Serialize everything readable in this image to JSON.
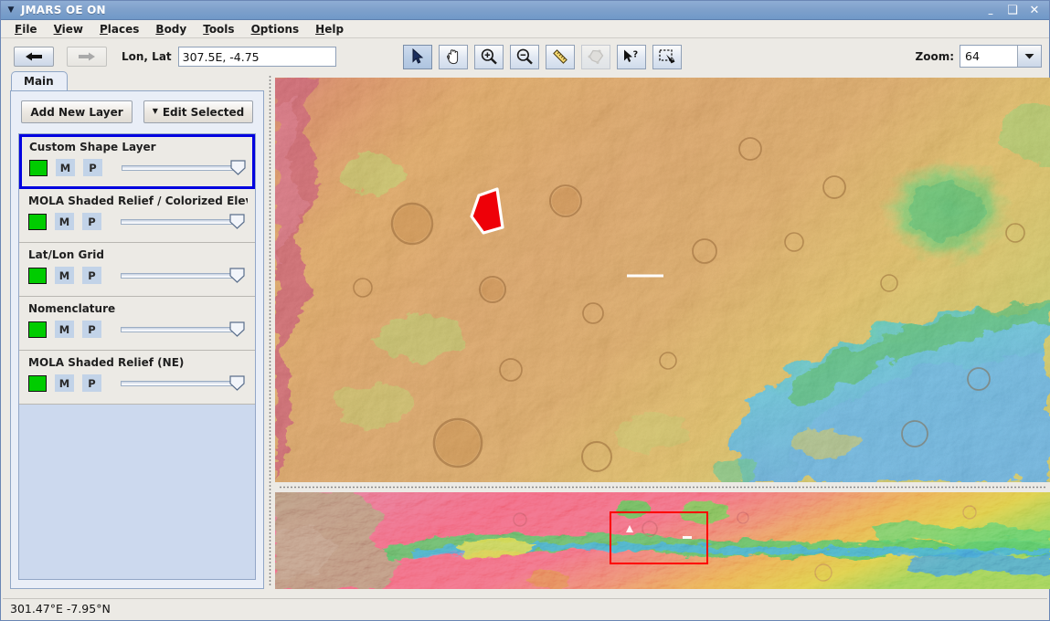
{
  "window": {
    "title": "JMARS OE ON",
    "menu_icon": "window-menu-icon",
    "minimize": "–",
    "maximize": "❑",
    "close": "✕"
  },
  "menubar": {
    "items": [
      {
        "label": "File",
        "mnemonic": "F"
      },
      {
        "label": "View",
        "mnemonic": "V"
      },
      {
        "label": "Places",
        "mnemonic": "P"
      },
      {
        "label": "Body",
        "mnemonic": "B"
      },
      {
        "label": "Tools",
        "mnemonic": "T"
      },
      {
        "label": "Options",
        "mnemonic": "O"
      },
      {
        "label": "Help",
        "mnemonic": "H"
      }
    ]
  },
  "toolbar": {
    "back_icon": "arrow-left-icon",
    "forward_icon": "arrow-right-icon",
    "back_enabled": true,
    "forward_enabled": false,
    "lonlat_label": "Lon, Lat",
    "lonlat_value": "307.5E, -4.75",
    "lonlat_placeholder": "Lon, Lat",
    "tools": [
      {
        "name": "select-arrow-tool",
        "active": true,
        "enabled": true
      },
      {
        "name": "pan-hand-tool",
        "active": false,
        "enabled": true
      },
      {
        "name": "zoom-in-tool",
        "active": false,
        "enabled": true
      },
      {
        "name": "zoom-out-tool",
        "active": false,
        "enabled": true
      },
      {
        "name": "measure-ruler-tool",
        "active": false,
        "enabled": true
      },
      {
        "name": "shape-tool",
        "active": false,
        "enabled": false
      },
      {
        "name": "investigate-tool",
        "active": false,
        "enabled": true
      },
      {
        "name": "region-select-tool",
        "active": false,
        "enabled": true
      }
    ],
    "zoom_label": "Zoom:",
    "zoom_value": "64",
    "zoom_arrow_icon": "chevron-down-icon"
  },
  "panel": {
    "tab_label": "Main",
    "add_layer_label": "Add New Layer",
    "edit_selected_label": "Edit Selected",
    "edit_caret_icon": "caret-down-icon",
    "layer_swatch_color": "#00cc00",
    "selection_border_color": "#0000e0",
    "layers": [
      {
        "name": "Custom Shape Layer",
        "selected": true,
        "m_label": "M",
        "p_label": "P",
        "opacity": 100
      },
      {
        "name": "MOLA Shaded Relief / Colorized Elevat…",
        "selected": false,
        "m_label": "M",
        "p_label": "P",
        "opacity": 100
      },
      {
        "name": "Lat/Lon Grid",
        "selected": false,
        "m_label": "M",
        "p_label": "P",
        "opacity": 100
      },
      {
        "name": "Nomenclature",
        "selected": false,
        "m_label": "M",
        "p_label": "P",
        "opacity": 100
      },
      {
        "name": "MOLA Shaded Relief (NE)",
        "selected": false,
        "m_label": "M",
        "p_label": "P",
        "opacity": 100
      }
    ]
  },
  "map": {
    "name": "main-map-view",
    "shape_fill": "#ee0008",
    "shape_outline": "#ffffff",
    "crosshair_color": "#ffffff"
  },
  "overview": {
    "name": "overview-map-view",
    "extent_box_color": "#ff0000"
  },
  "statusbar": {
    "coordinates": "301.47°E  -7.95°N"
  }
}
